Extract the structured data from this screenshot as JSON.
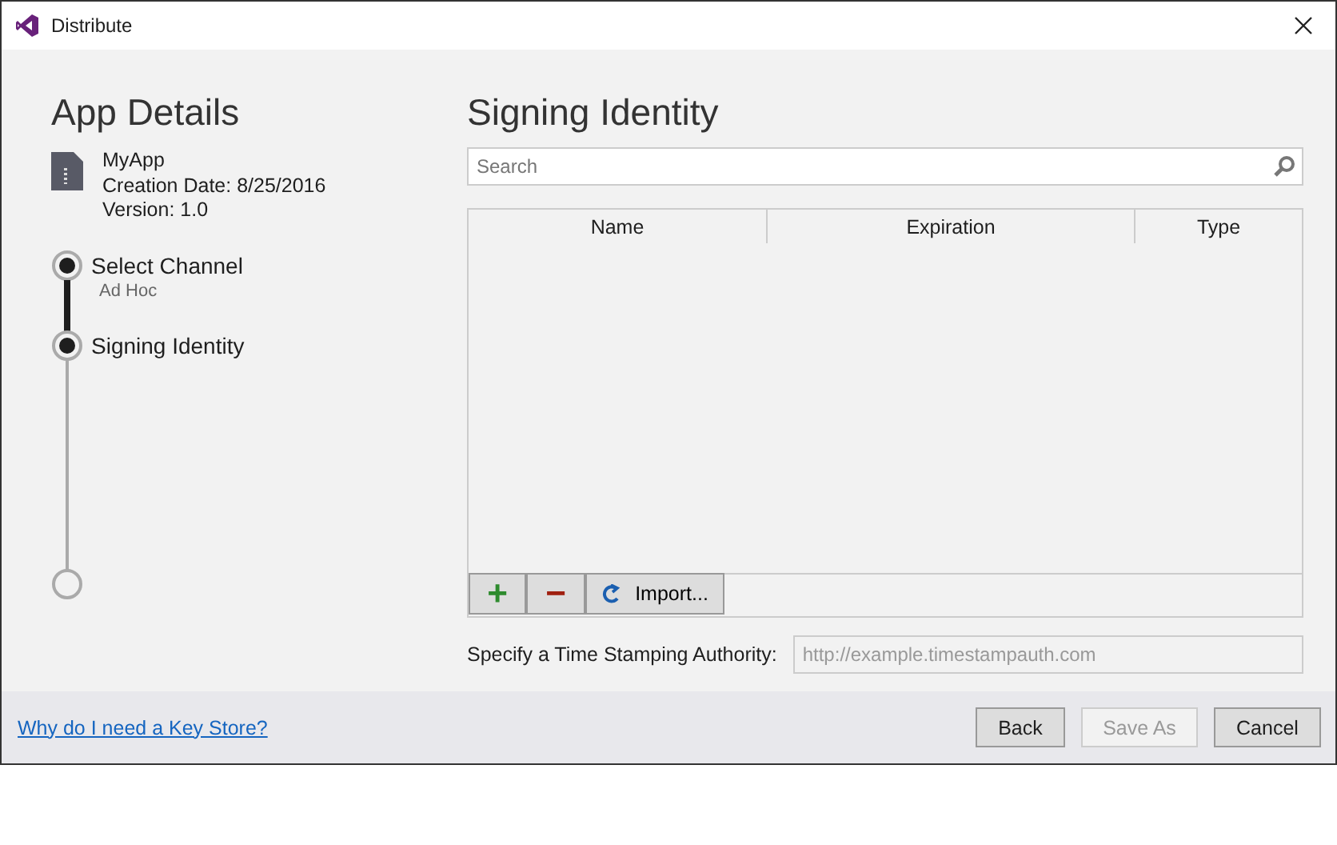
{
  "window": {
    "title": "Distribute"
  },
  "app_details": {
    "heading": "App Details",
    "name": "MyApp",
    "creation_date": "Creation Date: 8/25/2016",
    "version": "Version: 1.0"
  },
  "steps": [
    {
      "label": "Select Channel",
      "sublabel": "Ad Hoc",
      "done": true
    },
    {
      "label": "Signing Identity",
      "done": true
    }
  ],
  "final_step": {
    "done": false
  },
  "signing": {
    "heading": "Signing Identity",
    "search": {
      "placeholder": "Search"
    },
    "table": {
      "columns": [
        "Name",
        "Expiration",
        "Type"
      ]
    },
    "toolbar": {
      "add": "+",
      "remove": "−",
      "import": "Import..."
    },
    "timestamp": {
      "label": "Specify a Time Stamping Authority:",
      "placeholder": "http://example.timestampauth.com",
      "disabled": true
    }
  },
  "footer": {
    "link": "Why do I need a Key Store?",
    "buttons": [
      {
        "label": "Back",
        "disabled": false
      },
      {
        "label": "Save As",
        "disabled": true
      },
      {
        "label": "Cancel",
        "disabled": false
      }
    ]
  }
}
